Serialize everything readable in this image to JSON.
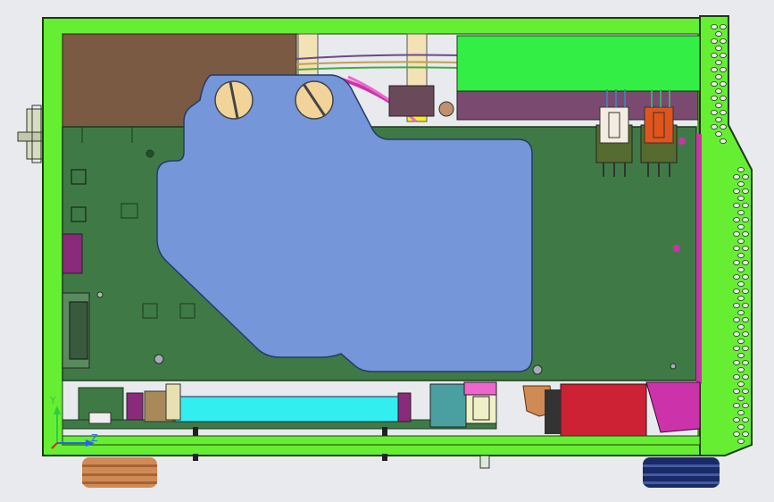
{
  "viewport": {
    "background": "#e8eaed"
  },
  "colors": {
    "frame_green": "#66ee33",
    "frame_outline": "#1c3a10",
    "pcb_green": "#3f7a46",
    "pcb_outline": "#1a3a1c",
    "heatsink_blue": "#7596d8",
    "brown_panel": "#7a5a42",
    "bright_green_block": "#33ee44",
    "cyan_connector": "#33eeee",
    "red_block": "#cc2233",
    "magenta": "#cc33aa",
    "purple_bar": "#7a4a70",
    "copper": "#d08a55",
    "navy_foot": "#1a2a66",
    "screw_beige": "#f2d49a",
    "connector_orange": "#e0551c",
    "connector_white": "#f4ece0"
  },
  "triad": {
    "y_label": "Y",
    "z_label": "Z",
    "y_color": "#2ecc40",
    "z_color": "#2266ee",
    "x_color": "#dd2222"
  }
}
